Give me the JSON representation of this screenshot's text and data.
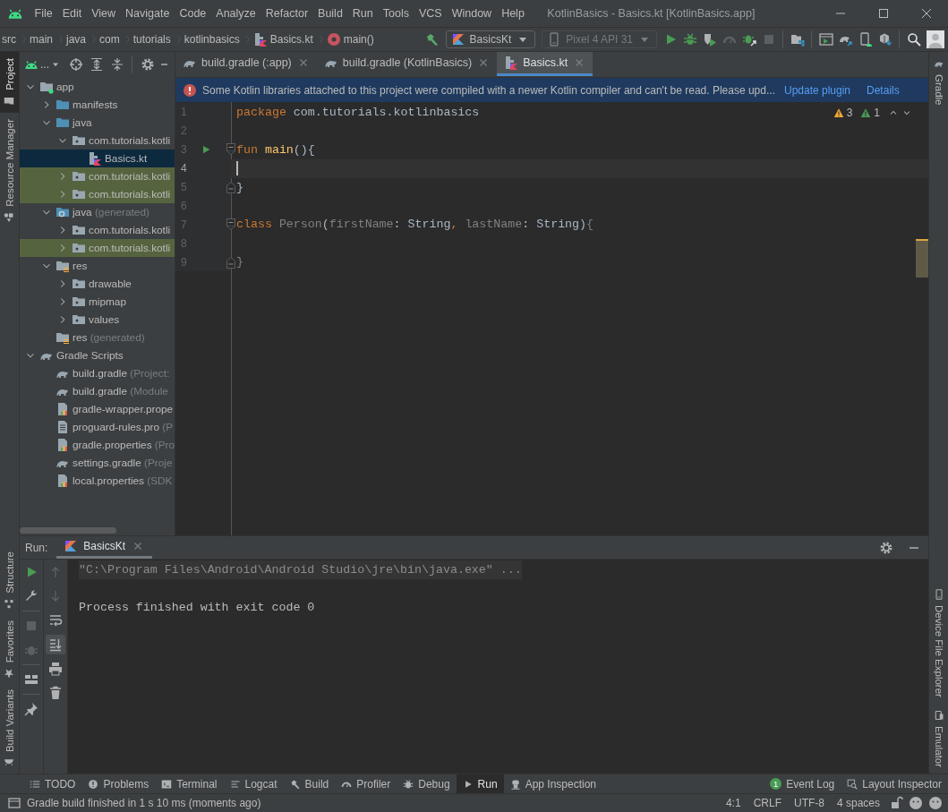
{
  "window": {
    "title": "KotlinBasics - Basics.kt [KotlinBasics.app]"
  },
  "menu": [
    "File",
    "Edit",
    "View",
    "Navigate",
    "Code",
    "Analyze",
    "Refactor",
    "Build",
    "Run",
    "Tools",
    "VCS",
    "Window",
    "Help"
  ],
  "breadcrumbs": [
    {
      "label": "src",
      "kind": "folder"
    },
    {
      "label": "main",
      "kind": "folder"
    },
    {
      "label": "java",
      "kind": "folder"
    },
    {
      "label": "com",
      "kind": "folder"
    },
    {
      "label": "tutorials",
      "kind": "folder"
    },
    {
      "label": "kotlinbasics",
      "kind": "folder"
    },
    {
      "label": "Basics.kt",
      "kind": "kotlin-file"
    },
    {
      "label": "main()",
      "kind": "function"
    }
  ],
  "run_toolbar": {
    "configuration": "BasicsKt",
    "device": {
      "label": "Pixel 4 API 31",
      "disabled": true
    }
  },
  "left_stripe": {
    "top": [
      {
        "label": "Project",
        "selected": true
      },
      {
        "label": "Resource Manager",
        "selected": false
      }
    ],
    "bottom": [
      {
        "label": "Structure",
        "selected": false
      },
      {
        "label": "Favorites",
        "selected": false
      },
      {
        "label": "Build Variants",
        "selected": false
      }
    ]
  },
  "right_stripe": {
    "top": [
      {
        "label": "Gradle",
        "selected": false
      }
    ],
    "bottom": [
      {
        "label": "Device File Explorer",
        "selected": false
      },
      {
        "label": "Emulator",
        "selected": false
      }
    ]
  },
  "project_panel": {
    "view": "...",
    "tree": [
      {
        "label": "app",
        "kind": "module",
        "expanded": true,
        "selected": false,
        "highlighted": false,
        "children": [
          {
            "label": "manifests",
            "kind": "source-folder",
            "expanded": false,
            "selected": false,
            "highlighted": false
          },
          {
            "label": "java",
            "kind": "source-folder",
            "expanded": true,
            "selected": false,
            "highlighted": false,
            "children": [
              {
                "label": "com.tutorials.kotli",
                "kind": "package",
                "expanded": true,
                "selected": false,
                "highlighted": false,
                "children": [
                  {
                    "label": "Basics.kt",
                    "kind": "kotlin-file",
                    "selected": true,
                    "highlighted": false
                  }
                ]
              },
              {
                "label": "com.tutorials.kotli",
                "kind": "package",
                "expanded": false,
                "selected": false,
                "highlighted": true
              },
              {
                "label": "com.tutorials.kotli",
                "kind": "package",
                "expanded": false,
                "selected": false,
                "highlighted": true
              }
            ]
          },
          {
            "label": "java",
            "suffix": "(generated)",
            "kind": "generated-folder",
            "expanded": true,
            "selected": false,
            "highlighted": false,
            "children": [
              {
                "label": "com.tutorials.kotli",
                "kind": "package",
                "expanded": false,
                "selected": false,
                "highlighted": false
              },
              {
                "label": "com.tutorials.kotli",
                "kind": "package",
                "expanded": false,
                "selected": false,
                "highlighted": true
              }
            ]
          },
          {
            "label": "res",
            "kind": "res-folder",
            "expanded": true,
            "selected": false,
            "highlighted": false,
            "children": [
              {
                "label": "drawable",
                "kind": "package",
                "expanded": false,
                "selected": false,
                "highlighted": false
              },
              {
                "label": "mipmap",
                "kind": "package",
                "expanded": false,
                "selected": false,
                "highlighted": false
              },
              {
                "label": "values",
                "kind": "package",
                "expanded": false,
                "selected": false,
                "highlighted": false
              }
            ]
          },
          {
            "label": "res",
            "suffix": "(generated)",
            "kind": "res-folder",
            "selected": false,
            "highlighted": false
          }
        ]
      },
      {
        "label": "Gradle Scripts",
        "kind": "gradle",
        "expanded": true,
        "selected": false,
        "highlighted": false,
        "children": [
          {
            "label": "build.gradle",
            "suffix": "(Project:",
            "kind": "gradle",
            "selected": false,
            "highlighted": false
          },
          {
            "label": "build.gradle",
            "suffix": "(Module",
            "kind": "gradle",
            "selected": false,
            "highlighted": false
          },
          {
            "label": "gradle-wrapper.prope",
            "kind": "properties",
            "selected": false,
            "highlighted": false
          },
          {
            "label": "proguard-rules.pro",
            "suffix": "(P",
            "kind": "text-file",
            "selected": false,
            "highlighted": false
          },
          {
            "label": "gradle.properties",
            "suffix": "(Pro",
            "kind": "properties",
            "selected": false,
            "highlighted": false
          },
          {
            "label": "settings.gradle",
            "suffix": "(Proje",
            "kind": "gradle",
            "selected": false,
            "highlighted": false
          },
          {
            "label": "local.properties",
            "suffix": "(SDK",
            "kind": "properties",
            "selected": false,
            "highlighted": false
          }
        ]
      }
    ]
  },
  "editor": {
    "tabs": [
      {
        "label": "build.gradle (:app)",
        "kind": "gradle",
        "selected": false
      },
      {
        "label": "build.gradle (KotlinBasics)",
        "kind": "gradle",
        "selected": false
      },
      {
        "label": "Basics.kt",
        "kind": "kotlin-file",
        "selected": true
      }
    ],
    "notification": {
      "message": "Some Kotlin libraries attached to this project were compiled with a newer Kotlin compiler and can't be read. Please upd...",
      "links": [
        "Update plugin",
        "Details"
      ]
    },
    "inspections": {
      "warnings": "3",
      "weak_warnings": "1"
    },
    "lines": [
      {
        "number": "1",
        "run_marker": false,
        "current": false,
        "fold_start": false,
        "fold_end": false,
        "tokens": [
          {
            "text": "package",
            "kind": "keyword"
          },
          {
            "text": " com.tutorials.kotlinbasics",
            "kind": "plain"
          }
        ]
      },
      {
        "number": "2",
        "run_marker": false,
        "current": false,
        "fold_start": false,
        "fold_end": false
      },
      {
        "number": "3",
        "run_marker": true,
        "current": false,
        "fold_start": true,
        "fold_end": false,
        "tokens": [
          {
            "text": "fun",
            "kind": "keyword"
          },
          {
            "text": " main",
            "kind": "function"
          },
          {
            "text": "(){",
            "kind": "plain"
          }
        ]
      },
      {
        "number": "4",
        "run_marker": false,
        "current": true,
        "fold_start": false,
        "fold_end": false
      },
      {
        "number": "5",
        "run_marker": false,
        "current": false,
        "fold_start": false,
        "fold_end": true,
        "tokens": [
          {
            "text": "}",
            "kind": "plain"
          }
        ]
      },
      {
        "number": "6",
        "run_marker": false,
        "current": false,
        "fold_start": false,
        "fold_end": false
      },
      {
        "number": "7",
        "run_marker": false,
        "current": false,
        "fold_start": true,
        "fold_end": false,
        "tokens": [
          {
            "text": "class",
            "kind": "keyword"
          },
          {
            "text": " Person",
            "kind": "unused"
          },
          {
            "text": "(",
            "kind": "plain"
          },
          {
            "text": "firstName",
            "kind": "unused"
          },
          {
            "text": ": String",
            "kind": "plain"
          },
          {
            "text": ",",
            "kind": "keyword"
          },
          {
            "text": " lastName",
            "kind": "unused"
          },
          {
            "text": ": String)",
            "kind": "plain"
          },
          {
            "text": "{",
            "kind": "unused"
          }
        ]
      },
      {
        "number": "8",
        "run_marker": false,
        "current": false,
        "fold_start": false,
        "fold_end": false
      },
      {
        "number": "9",
        "run_marker": false,
        "current": false,
        "fold_start": false,
        "fold_end": true,
        "tokens": [
          {
            "text": "}",
            "kind": "unused"
          }
        ]
      }
    ]
  },
  "run_panel": {
    "label": "Run:",
    "tabs": [
      {
        "label": "BasicsKt",
        "selected": true
      }
    ],
    "scroll_to_end": true,
    "output": [
      {
        "text": "\"C:\\Program Files\\Android\\Android Studio\\jre\\bin\\java.exe\" ...",
        "kind": "command"
      },
      {
        "text": "Process finished with exit code 0",
        "kind": "plain"
      }
    ]
  },
  "tool_window_bar": {
    "left": [
      {
        "label": "TODO",
        "selected": false
      },
      {
        "label": "Problems",
        "selected": false
      },
      {
        "label": "Terminal",
        "selected": false
      },
      {
        "label": "Logcat",
        "selected": false
      },
      {
        "label": "Build",
        "selected": false
      },
      {
        "label": "Profiler",
        "selected": false
      },
      {
        "label": "Debug",
        "selected": false
      },
      {
        "label": "Run",
        "selected": true
      },
      {
        "label": "App Inspection",
        "selected": false
      }
    ],
    "right": [
      {
        "label": "Event Log",
        "badge": "1"
      },
      {
        "label": "Layout Inspector"
      }
    ]
  },
  "status_bar": {
    "message": "Gradle build finished in 1 s 10 ms (moments ago)",
    "position": "4:1",
    "line_separator": "CRLF",
    "encoding": "UTF-8",
    "indent": "4 spaces"
  }
}
